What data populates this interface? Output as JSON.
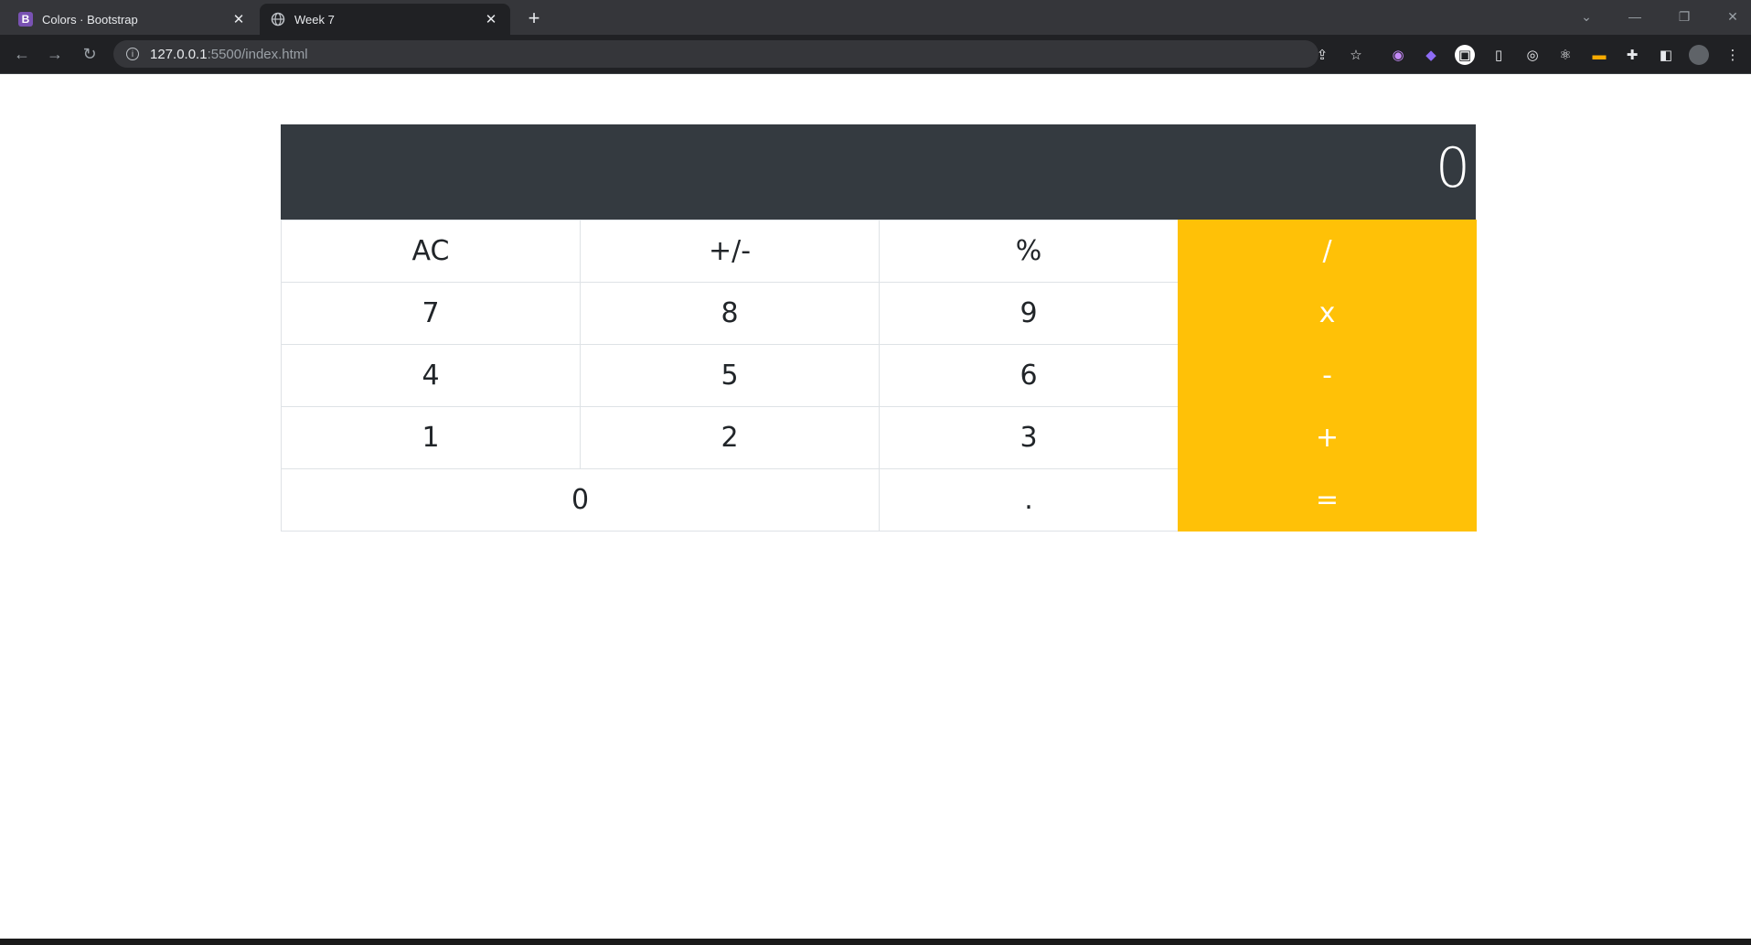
{
  "browser": {
    "tabs": [
      {
        "title": "Colors · Bootstrap",
        "favicon": "B",
        "active": false
      },
      {
        "title": "Week 7",
        "favicon": "globe-icon",
        "active": true
      }
    ],
    "close_glyph": "✕",
    "new_tab_glyph": "+",
    "url_host": "127.0.0.1",
    "url_path": ":5500/index.html"
  },
  "calculator": {
    "display_value": "0",
    "rows": [
      [
        {
          "label": "AC",
          "type": "func"
        },
        {
          "label": "+/-",
          "type": "func"
        },
        {
          "label": "%",
          "type": "func"
        },
        {
          "label": "/",
          "type": "op"
        }
      ],
      [
        {
          "label": "7",
          "type": "num"
        },
        {
          "label": "8",
          "type": "num"
        },
        {
          "label": "9",
          "type": "num"
        },
        {
          "label": "x",
          "type": "op"
        }
      ],
      [
        {
          "label": "4",
          "type": "num"
        },
        {
          "label": "5",
          "type": "num"
        },
        {
          "label": "6",
          "type": "num"
        },
        {
          "label": "-",
          "type": "op"
        }
      ],
      [
        {
          "label": "1",
          "type": "num"
        },
        {
          "label": "2",
          "type": "num"
        },
        {
          "label": "3",
          "type": "num"
        },
        {
          "label": "+",
          "type": "op"
        }
      ],
      [
        {
          "label": "0",
          "type": "num"
        },
        {
          "label": ".",
          "type": "num"
        },
        {
          "label": "=",
          "type": "op"
        }
      ]
    ],
    "colors": {
      "display_bg": "#343a40",
      "operator_bg": "#ffc107",
      "operator_text": "#ffffff",
      "key_border": "#dee2e6"
    }
  }
}
